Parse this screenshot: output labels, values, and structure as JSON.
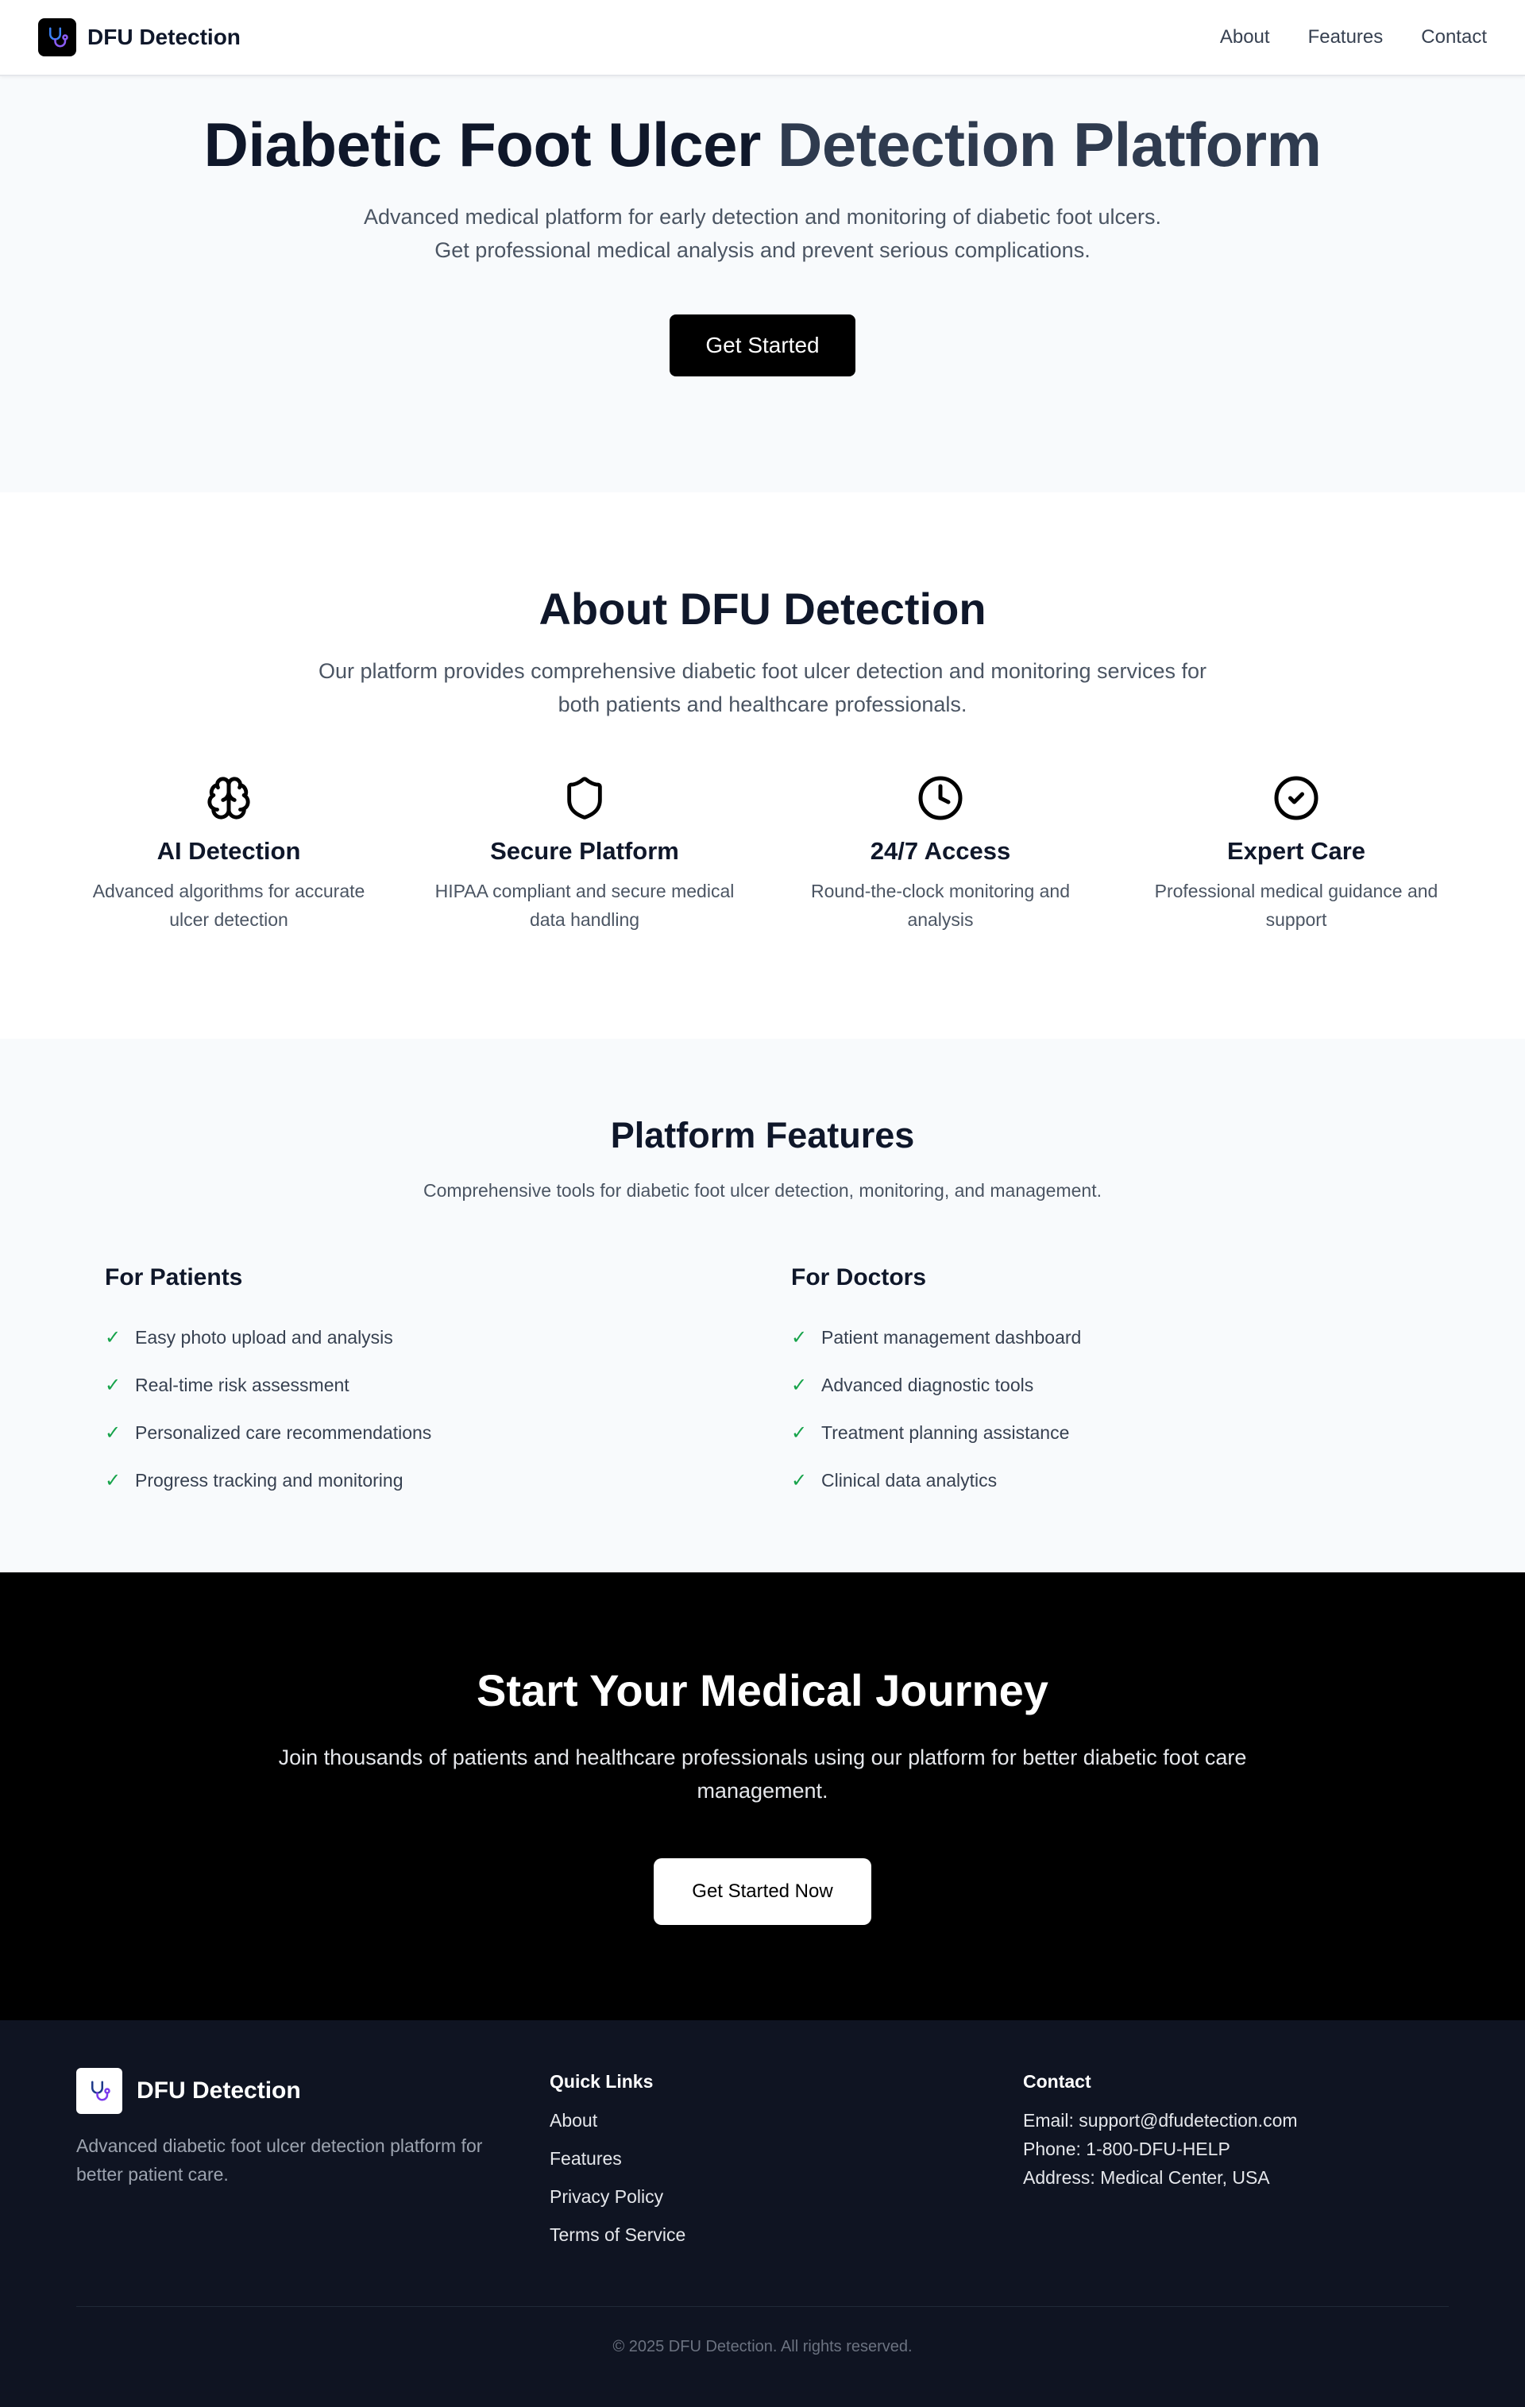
{
  "nav": {
    "brand": "DFU Detection",
    "links": [
      "About",
      "Features",
      "Contact"
    ]
  },
  "hero": {
    "title_main": "Diabetic Foot Ulcer ",
    "title_accent": "Detection Platform",
    "subtitle_line1": "Advanced medical platform for early detection and monitoring of diabetic foot ulcers.",
    "subtitle_line2": "Get professional medical analysis and prevent serious complications.",
    "cta": "Get Started"
  },
  "about": {
    "title": "About DFU Detection",
    "description": "Our platform provides comprehensive diabetic foot ulcer detection and monitoring services for both patients and healthcare professionals.",
    "cards": [
      {
        "icon": "brain-icon",
        "title": "AI Detection",
        "text": "Advanced algorithms for accurate ulcer detection"
      },
      {
        "icon": "shield-icon",
        "title": "Secure Platform",
        "text": "HIPAA compliant and secure medical data handling"
      },
      {
        "icon": "clock-icon",
        "title": "24/7 Access",
        "text": "Round-the-clock monitoring and analysis"
      },
      {
        "icon": "check-circle-icon",
        "title": "Expert Care",
        "text": "Professional medical guidance and support"
      }
    ]
  },
  "features": {
    "title": "Platform Features",
    "description": "Comprehensive tools for diabetic foot ulcer detection, monitoring, and management.",
    "patients": {
      "title": "For Patients",
      "items": [
        "Easy photo upload and analysis",
        "Real-time risk assessment",
        "Personalized care recommendations",
        "Progress tracking and monitoring"
      ]
    },
    "doctors": {
      "title": "For Doctors",
      "items": [
        "Patient management dashboard",
        "Advanced diagnostic tools",
        "Treatment planning assistance",
        "Clinical data analytics"
      ]
    },
    "check_glyph": "✓"
  },
  "cta": {
    "title": "Start Your Medical Journey",
    "description": "Join thousands of patients and healthcare professionals using our platform for better diabetic foot care management.",
    "button": "Get Started Now"
  },
  "footer": {
    "brand": "DFU Detection",
    "tagline": "Advanced diabetic foot ulcer detection platform for better patient care.",
    "quick_links_title": "Quick Links",
    "quick_links": [
      "About",
      "Features",
      "Privacy Policy",
      "Terms of Service"
    ],
    "contact_title": "Contact",
    "contact": [
      "Email: support@dfudetection.com",
      "Phone: 1-800-DFU-HELP",
      "Address: Medical Center, USA"
    ],
    "copyright": "© 2025 DFU Detection. All rights reserved."
  },
  "colors": {
    "accent_title": "#2f3b4f",
    "check_green": "#16a34a",
    "footer_bg": "#0f1422",
    "cta_bg": "#000000"
  }
}
